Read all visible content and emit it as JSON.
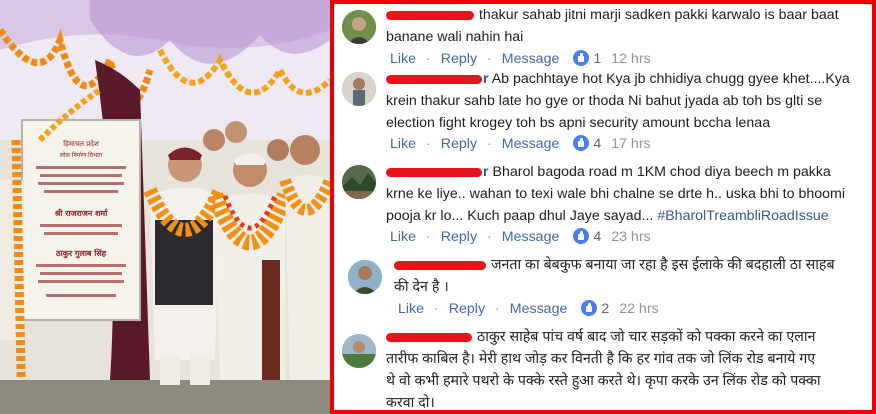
{
  "photo": {
    "plaque_header": "हिमाचल प्रदेश",
    "plaque_sub": "लोक निर्माण विभाग",
    "plaque_name_1": "श्री राजराजन शर्मा",
    "plaque_name_2": "ठाकुर गुलाब सिंह"
  },
  "comments": [
    {
      "author_visible": "",
      "text_lines": [
        "thakur sahab jitni marji sadken pakki karwalo is baar baat",
        "banane wali nahin hai"
      ],
      "actions": {
        "like": "Like",
        "reply": "Reply",
        "message": "Message"
      },
      "likes": "1",
      "time": "12 hrs"
    },
    {
      "author_visible": "r",
      "text_lines": [
        "Ab pachhtaye hot Kya jb chhidiya chugg gyee khet....Kya",
        "krein thakur sahb late ho gye or thoda Ni bahut jyada ab toh bs glti se",
        "election fight krogey toh bs apni security amount bccha lenaa"
      ],
      "actions": {
        "like": "Like",
        "reply": "Reply",
        "message": "Message"
      },
      "likes": "4",
      "time": "17 hrs"
    },
    {
      "author_visible": "r",
      "text_lines": [
        "Bharol bagoda road m 1KM chod diya beech m pakka",
        "krne ke liye.. wahan to texi wale bhi chalne se drte h.. uska bhi to bhoomi",
        "pooja kr lo... Kuch paap dhul Jaye sayad... "
      ],
      "hashtag": "#BharolTreambliRoadIssue",
      "actions": {
        "like": "Like",
        "reply": "Reply",
        "message": "Message"
      },
      "likes": "4",
      "time": "23 hrs"
    },
    {
      "author_visible": "",
      "text_lines": [
        "जनता का बेबकुफ बनाया जा रहा है इस ईलाके की बदहाली ठा साहब",
        "की देन है ।"
      ],
      "actions": {
        "like": "Like",
        "reply": "Reply",
        "message": "Message"
      },
      "likes": "2",
      "time": "22 hrs"
    },
    {
      "author_visible": "",
      "text_lines": [
        "ठाकुर साहेब पांच वर्ष बाद जो चार सड़कों को पक्का करने का एलान",
        "तारीफ काबिल है। मेरी हाथ जोड़ कर विनती है कि हर गांव तक जो लिंक रोड बनाये गए",
        "थे वो कभी हमारे पथरो के पक्के रस्ते हुआ करते थे। कृपा करके उन लिंक रोड को पक्का",
        "करवा दो।"
      ]
    }
  ],
  "colors": {
    "redaction": "#e8131b",
    "border": "#ee0000",
    "link": "#4267b2",
    "like_badge": "#4a7ef0"
  },
  "icons": {
    "like": "thumbs-up-icon"
  }
}
